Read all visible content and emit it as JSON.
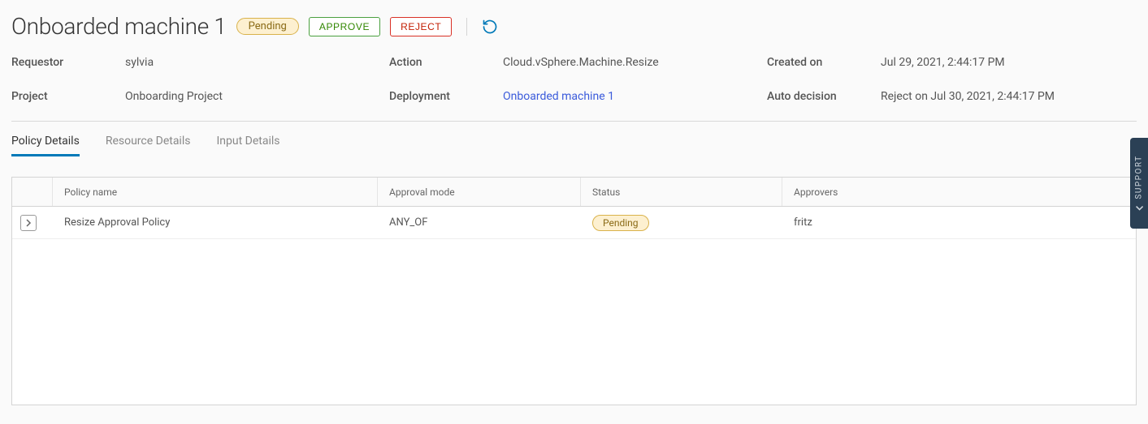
{
  "header": {
    "title": "Onboarded machine 1",
    "status": "Pending",
    "approve_label": "APPROVE",
    "reject_label": "REJECT"
  },
  "details": {
    "requestor_label": "Requestor",
    "requestor_value": "sylvia",
    "action_label": "Action",
    "action_value": "Cloud.vSphere.Machine.Resize",
    "created_label": "Created on",
    "created_value": "Jul 29, 2021, 2:44:17 PM",
    "project_label": "Project",
    "project_value": "Onboarding Project",
    "deployment_label": "Deployment",
    "deployment_value": "Onboarded machine 1",
    "autodecision_label": "Auto decision",
    "autodecision_value": "Reject on Jul 30, 2021, 2:44:17 PM"
  },
  "tabs": {
    "policy": "Policy Details",
    "resource": "Resource Details",
    "input": "Input Details"
  },
  "table": {
    "headers": {
      "name": "Policy name",
      "mode": "Approval mode",
      "status": "Status",
      "approvers": "Approvers"
    },
    "rows": [
      {
        "name": "Resize Approval Policy",
        "mode": "ANY_OF",
        "status": "Pending",
        "approvers": "fritz"
      }
    ]
  },
  "support": {
    "label": "SUPPORT"
  }
}
